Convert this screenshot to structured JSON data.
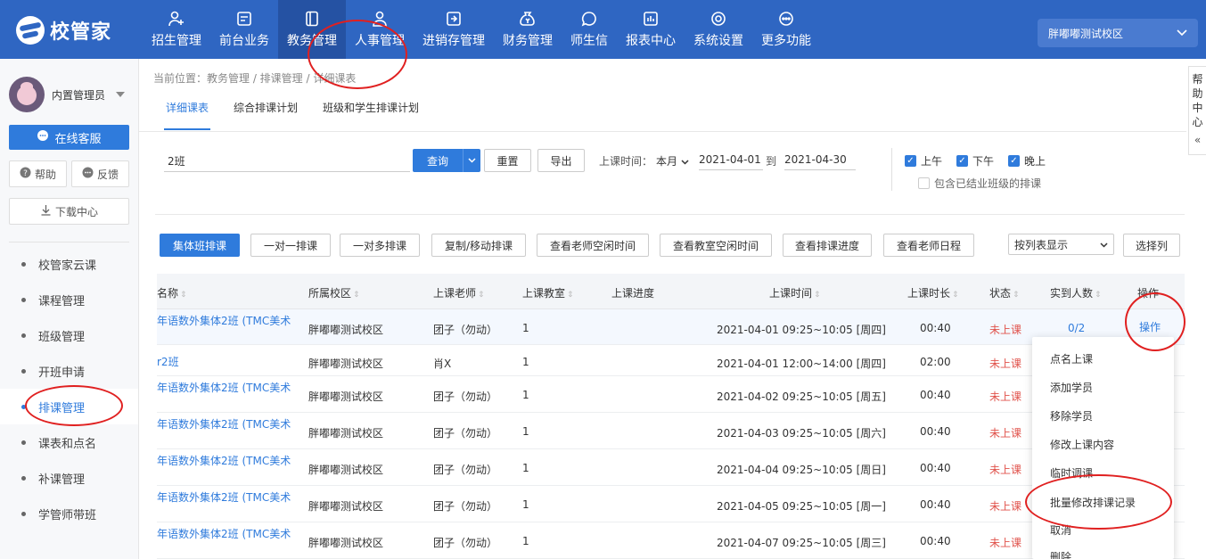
{
  "app": {
    "logo_text": "校管家"
  },
  "nav": [
    {
      "label": "招生管理",
      "icon": "user-plus-icon"
    },
    {
      "label": "前台业务",
      "icon": "screen-icon"
    },
    {
      "label": "教务管理",
      "icon": "book-icon",
      "active": true
    },
    {
      "label": "人事管理",
      "icon": "person-icon"
    },
    {
      "label": "进销存管理",
      "icon": "inventory-icon"
    },
    {
      "label": "财务管理",
      "icon": "money-bag-icon"
    },
    {
      "label": "师生信",
      "icon": "chat-icon"
    },
    {
      "label": "报表中心",
      "icon": "report-icon"
    },
    {
      "label": "系统设置",
      "icon": "settings-icon"
    },
    {
      "label": "更多功能",
      "icon": "more-icon"
    }
  ],
  "campus": {
    "label": "胖嘟嘟测试校区"
  },
  "sidebar": {
    "user_name": "内置管理员",
    "online_service": "在线客服",
    "help": "帮助",
    "feedback": "反馈",
    "download": "下载中心",
    "items": [
      {
        "label": "校管家云课"
      },
      {
        "label": "课程管理"
      },
      {
        "label": "班级管理"
      },
      {
        "label": "开班申请"
      },
      {
        "label": "排课管理",
        "active": true
      },
      {
        "label": "课表和点名"
      },
      {
        "label": "补课管理"
      },
      {
        "label": "学管师带班"
      }
    ]
  },
  "breadcrumb": "当前位置：教务管理 / 排课管理 / 详细课表",
  "tabs": [
    "详细课表",
    "综合排课计划",
    "班级和学生排课计划"
  ],
  "filters": {
    "search_value": "2班",
    "query": "查询",
    "reset": "重置",
    "export": "导出",
    "time_label": "上课时间：",
    "time_range": "本月",
    "date_from": "2021-04-01",
    "to": "到",
    "date_to": "2021-04-30",
    "morning": "上午",
    "afternoon": "下午",
    "evening": "晚上",
    "include_finished": "包含已结业班级的排课"
  },
  "actions": {
    "group_class": "集体班排课",
    "one_to_one": "一对一排课",
    "one_to_many": "一对多排课",
    "copy_move": "复制/移动排课",
    "teacher_free": "查看老师空闲时间",
    "room_free": "查看教室空闲时间",
    "progress": "查看排课进度",
    "teacher_schedule": "查看老师日程",
    "view_mode": "按列表显示",
    "choose_columns": "选择列"
  },
  "table": {
    "headers": {
      "name": "名称",
      "campus": "所属校区",
      "teacher": "上课老师",
      "room": "上课教室",
      "progress": "上课进度",
      "time": "上课时间",
      "duration": "上课时长",
      "status": "状态",
      "attendance": "实到人数",
      "ops": "操作"
    },
    "rows": [
      {
        "name": "年语数外集体2班 (TMC美术",
        "campus": "胖嘟嘟测试校区",
        "teacher": "团子（勿动）",
        "room": "1",
        "time": "2021-04-01 09:25~10:05 [周四]",
        "duration": "00:40",
        "status": "未上课",
        "attendance": "0/2",
        "op": "操作"
      },
      {
        "name": "r2班",
        "campus": "胖嘟嘟测试校区",
        "teacher": "肖X",
        "room": "1",
        "time": "2021-04-01 12:00~14:00 [周四]",
        "duration": "02:00",
        "status": "未上课"
      },
      {
        "name": "年语数外集体2班 (TMC美术",
        "campus": "胖嘟嘟测试校区",
        "teacher": "团子（勿动）",
        "room": "1",
        "time": "2021-04-02 09:25~10:05 [周五]",
        "duration": "00:40",
        "status": "未上课"
      },
      {
        "name": "年语数外集体2班 (TMC美术",
        "campus": "胖嘟嘟测试校区",
        "teacher": "团子（勿动）",
        "room": "1",
        "time": "2021-04-03 09:25~10:05 [周六]",
        "duration": "00:40",
        "status": "未上课"
      },
      {
        "name": "年语数外集体2班 (TMC美术",
        "campus": "胖嘟嘟测试校区",
        "teacher": "团子（勿动）",
        "room": "1",
        "time": "2021-04-04 09:25~10:05 [周日]",
        "duration": "00:40",
        "status": "未上课"
      },
      {
        "name": "年语数外集体2班 (TMC美术",
        "campus": "胖嘟嘟测试校区",
        "teacher": "团子（勿动）",
        "room": "1",
        "time": "2021-04-05 09:25~10:05 [周一]",
        "duration": "00:40",
        "status": "未上课"
      },
      {
        "name": "年语数外集体2班 (TMC美术",
        "campus": "胖嘟嘟测试校区",
        "teacher": "团子（勿动）",
        "room": "1",
        "time": "2021-04-07 09:25~10:05 [周三]",
        "duration": "00:40",
        "status": "未上课"
      }
    ]
  },
  "popup_menu": [
    "点名上课",
    "添加学员",
    "移除学员",
    "修改上课内容",
    "临时调课",
    "批量修改排课记录",
    "取消",
    "删除"
  ],
  "helper": {
    "chars": [
      "帮",
      "助",
      "中",
      "心"
    ],
    "arrow": "«"
  },
  "colors": {
    "brand": "#2f66c2",
    "accent": "#2f7bdc",
    "status_red": "#e0524b",
    "annotation": "#e02020"
  }
}
